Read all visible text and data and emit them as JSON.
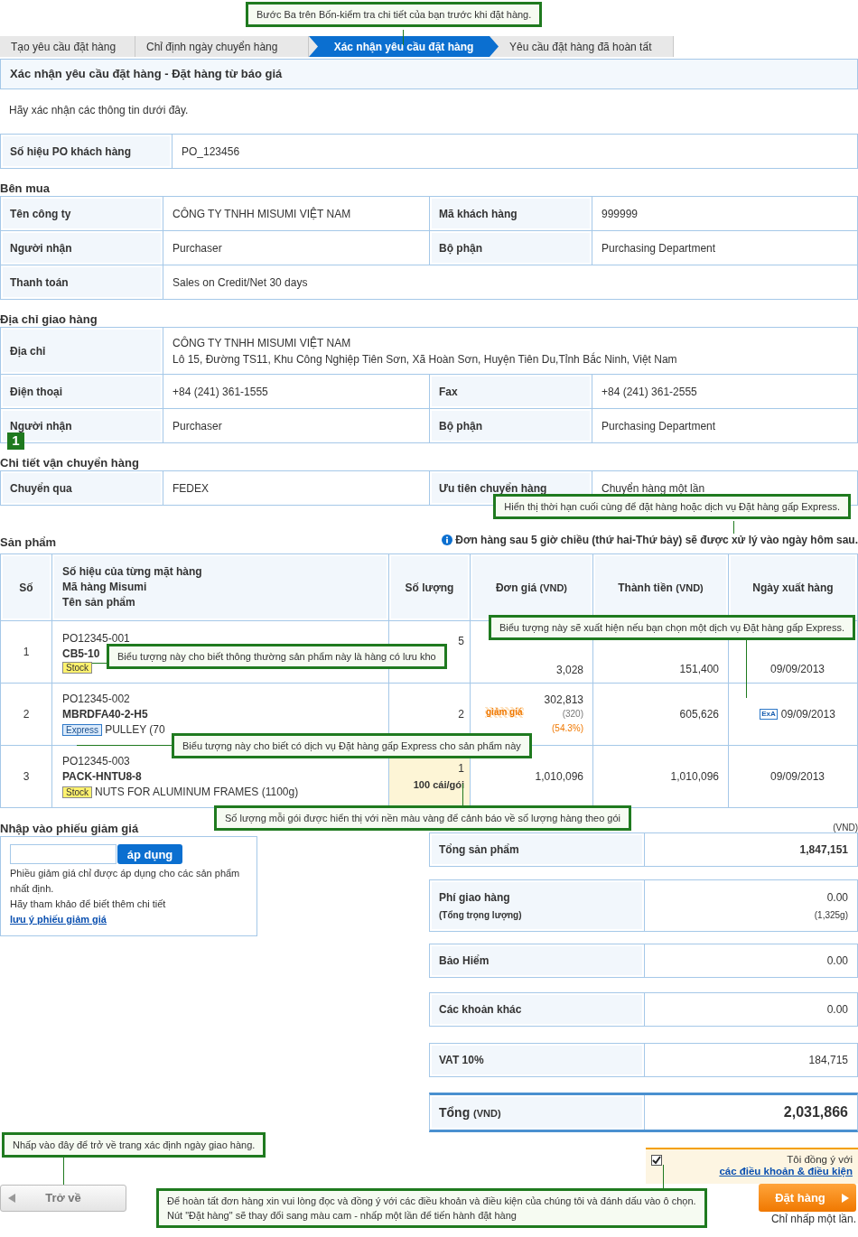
{
  "steps": [
    {
      "label": "Tạo yêu cầu đặt hàng",
      "selected": false
    },
    {
      "label": "Chỉ định ngày chuyển hàng",
      "selected": false
    },
    {
      "label": "Xác nhận yêu cầu đặt hàng",
      "selected": true
    },
    {
      "label": "Yêu cầu đặt hàng đã hoàn tất",
      "selected": false
    }
  ],
  "page_title": "Xác nhận yêu cầu đặt hàng - Đặt hàng từ báo giá",
  "intro": "Hãy xác nhận các thông tin dưới đây.",
  "po": {
    "label": "Số hiệu PO khách hàng",
    "value": "PO_123456"
  },
  "sections": [
    {
      "heading": "Bên mua",
      "rows": [
        {
          "cells": [
            {
              "label": "Tên công ty",
              "value": "CÔNG TY TNHH MISUMI VIỆT NAM"
            },
            {
              "label": "Mã khách hàng",
              "value": "999999"
            }
          ]
        },
        {
          "cells": [
            {
              "label": "Người nhận",
              "value": "Purchaser"
            },
            {
              "label": "Bộ phận",
              "value": "Purchasing Department"
            }
          ]
        },
        {
          "cells": [
            {
              "label": "Thanh toán",
              "value": "Sales on Credit/Net 30 days"
            }
          ]
        }
      ]
    },
    {
      "heading": "Địa chỉ giao hàng",
      "rows": [
        {
          "cells": [
            {
              "label": "Địa chỉ",
              "lines": [
                "CÔNG TY TNHH MISUMI VIỆT NAM",
                "Lô 15, Đường TS11, Khu Công Nghiệp Tiên Sơn, Xã Hoàn Sơn, Huyện Tiên Du,Tỉnh Bắc Ninh, Việt Nam"
              ]
            }
          ]
        },
        {
          "cells": [
            {
              "label": "Điện thoại",
              "value": "+84 (241) 361-1555"
            },
            {
              "label": "Fax",
              "value": "+84 (241) 361-2555"
            }
          ]
        },
        {
          "cells": [
            {
              "label": "Người nhận",
              "value": "Purchaser"
            },
            {
              "label": "Bộ phận",
              "value": "Purchasing Department"
            }
          ]
        }
      ]
    },
    {
      "heading": "Chi tiết vận chuyển hàng",
      "marker": "1",
      "rows": [
        {
          "cells": [
            {
              "label": "Chuyển qua",
              "value": "FEDEX"
            },
            {
              "label": "Ưu tiên chuyển hàng",
              "value": "Chuyển hàng một lần"
            }
          ]
        }
      ]
    }
  ],
  "products": {
    "heading": "Sản phẩm",
    "note": "Đơn hàng sau 5 giờ chiều (thứ hai-Thứ bảy) sẽ được xử lý vào ngày hôm sau.",
    "columns": [
      {
        "lines": [
          "Số"
        ]
      },
      {
        "lines": [
          "Số hiệu của từng mặt hàng",
          "Mã hàng Misumi",
          "Tên sản phẩm"
        ]
      },
      {
        "lines": [
          "Số lượng"
        ]
      },
      {
        "lines": [
          "Đơn giá"
        ],
        "unit": "(VND)"
      },
      {
        "lines": [
          "Thành tiền"
        ],
        "unit": "(VND)"
      },
      {
        "lines": [
          "Ngày xuất hàng"
        ]
      }
    ],
    "rows": [
      {
        "no": "1",
        "po": "PO12345-001",
        "code": "CB5-10",
        "badge": {
          "kind": "stock",
          "label": "Stock"
        },
        "qty": "5",
        "unit_price": "3,028",
        "total": "151,400",
        "ship_date": "09/09/2013"
      },
      {
        "no": "2",
        "po": "PO12345-002",
        "code": "MBRDFA40-2-H5",
        "badge": {
          "kind": "express",
          "label": "Express"
        },
        "name": "PULLEY (70",
        "qty": "2",
        "unit_price": "302,813",
        "list_price": "(320)",
        "discount_rate": "(54.3%)",
        "discount_label": "giảm giá",
        "total": "605,626",
        "express_mark": "ExA",
        "ship_date": "09/09/2013"
      },
      {
        "no": "3",
        "po": "PO12345-003",
        "code": "PACK-HNTU8-8",
        "badge": {
          "kind": "stock",
          "label": "Stock"
        },
        "name": "NUTS FOR ALUMINUM FRAMES (1100g)",
        "qty": "1",
        "pack": "100 cái/gói",
        "pack_warning": true,
        "unit_price": "1,010,096",
        "total": "1,010,096",
        "ship_date": "09/09/2013"
      }
    ]
  },
  "coupon": {
    "heading": "Nhập vào phiếu giảm giá",
    "button": "áp dụng",
    "note": "Phiều giảm giá chỉ được áp dụng cho các sản phẩm nhất định.",
    "more": "Hãy tham khảo để biết thêm chi tiết",
    "link": "lưu ý phiếu giảm giá"
  },
  "totals": {
    "currency": "(VND)",
    "rows": [
      {
        "kind": "subtotal",
        "label": "Tổng sản phẩm",
        "value": "1,847,151"
      },
      {
        "kind": "line",
        "label": "Phí giao hàng",
        "sublabel": "(Tổng trọng lượng)",
        "value": "0.00",
        "subvalue": "(1,325g)"
      },
      {
        "kind": "line",
        "label": "Bảo Hiểm",
        "value": "0.00"
      },
      {
        "kind": "line",
        "label": "Các khoản khác",
        "value": "0.00"
      },
      {
        "kind": "line",
        "label": "VAT 10%",
        "value": "184,715"
      },
      {
        "kind": "grand",
        "label": "Tổng",
        "unit": "(VND)",
        "value": "2,031,866"
      }
    ]
  },
  "back_button": "Trở về",
  "agreement": {
    "checked": true,
    "text": "Tôi đồng ý với",
    "link": "các điều khoản & điều kiện"
  },
  "order_button": "Đặt hàng",
  "order_note": "Chỉ nhấp một lần.",
  "callouts": [
    {
      "lines": [
        "Bước Ba trên Bốn-kiểm tra chi tiết của bạn trước khi đặt hàng."
      ]
    },
    {
      "lines": [
        "Hiển thị thời hạn cuối cùng để đặt hàng hoặc dịch vụ Đặt hàng gấp Express."
      ]
    },
    {
      "lines": [
        "Biểu tượng này sẽ xuất hiện nếu bạn chọn một dịch vụ Đặt hàng gấp Express."
      ]
    },
    {
      "lines": [
        "Biểu tượng này cho biết thông thường sản phẩm này là hàng có lưu kho"
      ]
    },
    {
      "lines": [
        "Biểu tượng này cho biết có dịch vụ Đặt hàng gấp Express cho sản phẩm này"
      ]
    },
    {
      "lines": [
        "Số lượng mỗi gói được hiển thị với nền màu vàng để cảnh báo về số lượng hàng theo gói"
      ]
    },
    {
      "lines": [
        "Nhấp vào đây để trở về trang xác định ngày giao hàng."
      ]
    },
    {
      "lines": [
        "Để hoàn tất đơn hàng xin vui lòng đọc và đồng ý với các điều khoản và điều kiện của chúng tôi và đánh dấu vào ô chọn.",
        "Nút \"Đặt hàng\" sẽ thay đổi sang màu cam - nhấp một lần để tiến hành đặt hàng"
      ]
    }
  ]
}
